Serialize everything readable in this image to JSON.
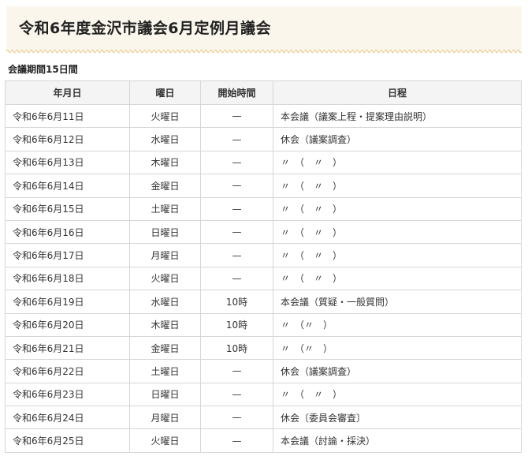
{
  "page": {
    "title": "令和6年度金沢市議会6月定例月議会",
    "period": "会議期間15日間"
  },
  "table": {
    "headers": [
      "年月日",
      "曜日",
      "開始時間",
      "日程"
    ],
    "rows": [
      {
        "date": "令和6年6月11日",
        "day": "火曜日",
        "time": "—",
        "schedule": "本会議（議案上程・提案理由説明）"
      },
      {
        "date": "令和6年6月12日",
        "day": "水曜日",
        "time": "—",
        "schedule": "休会（議案調査）"
      },
      {
        "date": "令和6年6月13日",
        "day": "木曜日",
        "time": "—",
        "schedule": "〃　（　〃　）"
      },
      {
        "date": "令和6年6月14日",
        "day": "金曜日",
        "time": "—",
        "schedule": "〃　（　〃　）"
      },
      {
        "date": "令和6年6月15日",
        "day": "土曜日",
        "time": "—",
        "schedule": "〃　（　〃　）"
      },
      {
        "date": "令和6年6月16日",
        "day": "日曜日",
        "time": "—",
        "schedule": "〃　（　〃　）"
      },
      {
        "date": "令和6年6月17日",
        "day": "月曜日",
        "time": "—",
        "schedule": "〃　（　〃　）"
      },
      {
        "date": "令和6年6月18日",
        "day": "火曜日",
        "time": "—",
        "schedule": "〃　（　〃　）"
      },
      {
        "date": "令和6年6月19日",
        "day": "水曜日",
        "time": "10時",
        "schedule": "本会議（質疑・一般質問）"
      },
      {
        "date": "令和6年6月20日",
        "day": "木曜日",
        "time": "10時",
        "schedule": "〃　（〃　）"
      },
      {
        "date": "令和6年6月21日",
        "day": "金曜日",
        "time": "10時",
        "schedule": "〃　（〃　）"
      },
      {
        "date": "令和6年6月22日",
        "day": "土曜日",
        "time": "—",
        "schedule": "休会（議案調査）"
      },
      {
        "date": "令和6年6月23日",
        "day": "日曜日",
        "time": "—",
        "schedule": "〃　（　〃　）"
      },
      {
        "date": "令和6年6月24日",
        "day": "月曜日",
        "time": "—",
        "schedule": "休会〔委員会審査〕"
      },
      {
        "date": "令和6年6月25日",
        "day": "火曜日",
        "time": "—",
        "schedule": "本会議（討論・採決）"
      }
    ]
  }
}
